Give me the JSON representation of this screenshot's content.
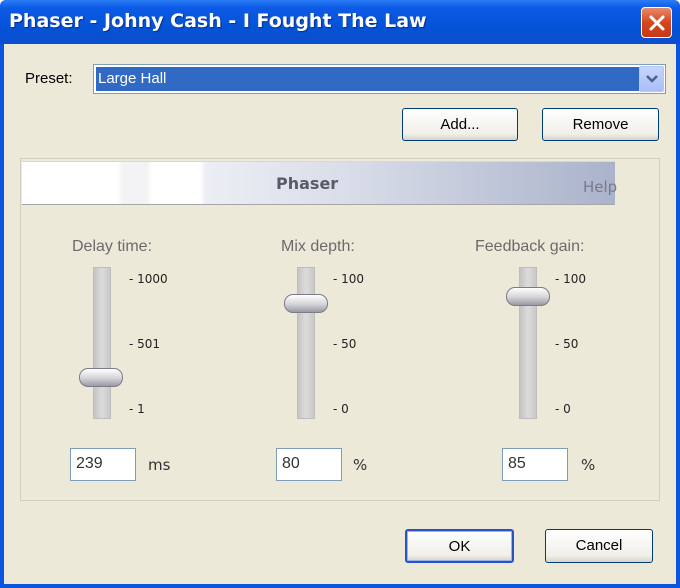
{
  "window": {
    "title": "Phaser - Johny Cash - I Fought The Law",
    "close_icon": "close-icon"
  },
  "preset": {
    "label": "Preset:",
    "selected": "Large Hall",
    "add_label": "Add...",
    "remove_label": "Remove"
  },
  "panel": {
    "title": "Phaser",
    "help_label": "Help"
  },
  "sliders": [
    {
      "label": "Delay time:",
      "ticks": [
        "1000",
        "501",
        "1"
      ],
      "value": "239",
      "unit": "ms",
      "level": 0.24
    },
    {
      "label": "Mix depth:",
      "ticks": [
        "100",
        "50",
        "0"
      ],
      "value": "80",
      "unit": "%",
      "level": 0.8
    },
    {
      "label": "Feedback gain:",
      "ticks": [
        "100",
        "50",
        "0"
      ],
      "value": "85",
      "unit": "%",
      "level": 0.85
    }
  ],
  "footer": {
    "ok_label": "OK",
    "cancel_label": "Cancel"
  },
  "colors": {
    "titlebar": "#0453d8",
    "selection": "#316ac5",
    "dialog_bg": "#ece9d8"
  }
}
